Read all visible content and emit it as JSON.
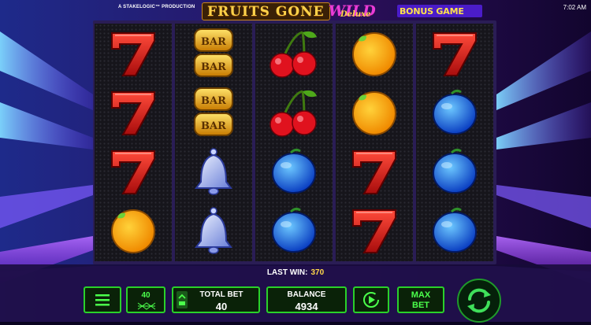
{
  "header": {
    "producer": "A STAKELOGIC™ PRODUCTION",
    "logo_fruits": "FRUITS GONE",
    "logo_wild": "WILD",
    "logo_deluxe": "Deluxe",
    "bonus_game": "BONUS GAME",
    "clock": "7:02 AM"
  },
  "reels": [
    [
      "seven",
      "seven",
      "seven",
      "orange"
    ],
    [
      "bar",
      "bar",
      "bell",
      "bell"
    ],
    [
      "cherry",
      "cherry",
      "plum",
      "plum"
    ],
    [
      "orange",
      "orange",
      "seven",
      "seven"
    ],
    [
      "seven",
      "plum",
      "plum",
      "plum"
    ]
  ],
  "last_win": {
    "label": "LAST WIN:",
    "value": "370"
  },
  "controls": {
    "lines": "40",
    "total_bet_label": "TOTAL BET",
    "total_bet_value": "40",
    "balance_label": "BALANCE",
    "balance_value": "4934",
    "max_bet_line1": "MAX",
    "max_bet_line2": "BET"
  },
  "colors": {
    "accent_green": "#2ad12a",
    "frame": "#2a1d55",
    "bonus_bg": "#4b1cc9"
  }
}
